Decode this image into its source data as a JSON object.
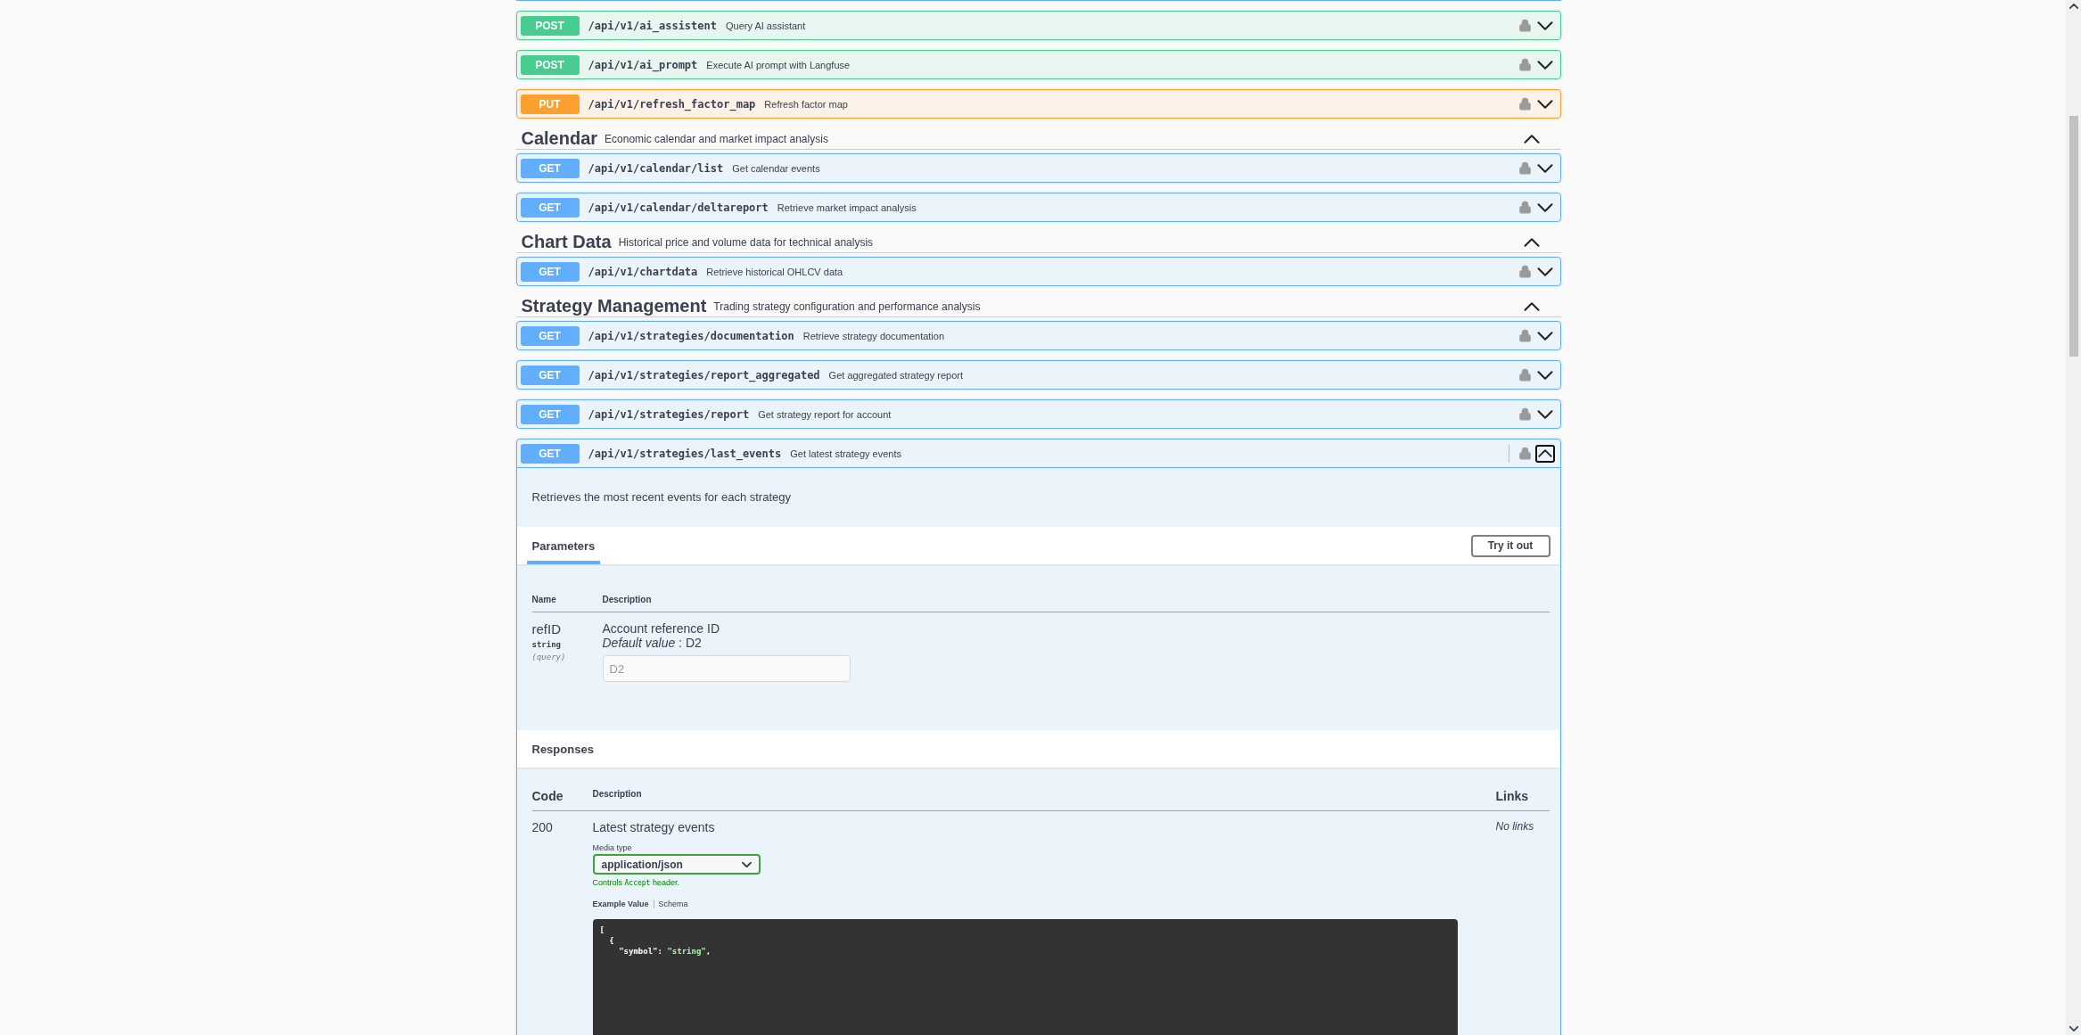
{
  "sections": [
    {
      "operations": [
        {
          "method": "POST",
          "path": "/api/v1/ai_assistent",
          "summary": "Query AI assistant",
          "expanded": false
        },
        {
          "method": "POST",
          "path": "/api/v1/ai_prompt",
          "summary": "Execute AI prompt with Langfuse",
          "expanded": false
        },
        {
          "method": "PUT",
          "path": "/api/v1/refresh_factor_map",
          "summary": "Refresh factor map",
          "expanded": false
        }
      ]
    },
    {
      "title": "Calendar",
      "description": "Economic calendar and market impact analysis",
      "expanded": true,
      "operations": [
        {
          "method": "GET",
          "path": "/api/v1/calendar/list",
          "summary": "Get calendar events",
          "expanded": false
        },
        {
          "method": "GET",
          "path": "/api/v1/calendar/deltareport",
          "summary": "Retrieve market impact analysis",
          "expanded": false
        }
      ]
    },
    {
      "title": "Chart Data",
      "description": "Historical price and volume data for technical analysis",
      "expanded": true,
      "operations": [
        {
          "method": "GET",
          "path": "/api/v1/chartdata",
          "summary": "Retrieve historical OHLCV data",
          "expanded": false
        }
      ]
    },
    {
      "title": "Strategy Management",
      "description": "Trading strategy configuration and performance analysis",
      "expanded": true,
      "operations": [
        {
          "method": "GET",
          "path": "/api/v1/strategies/documentation",
          "summary": "Retrieve strategy documentation",
          "expanded": false
        },
        {
          "method": "GET",
          "path": "/api/v1/strategies/report_aggregated",
          "summary": "Get aggregated strategy report",
          "expanded": false
        },
        {
          "method": "GET",
          "path": "/api/v1/strategies/report",
          "summary": "Get strategy report for account",
          "expanded": false
        },
        {
          "method": "GET",
          "path": "/api/v1/strategies/last_events",
          "summary": "Get latest strategy events",
          "expanded": true,
          "details": {
            "description": "Retrieves the most recent events for each strategy",
            "parameters_tab": "Parameters",
            "try_button": "Try it out",
            "param_columns": [
              "Name",
              "Description"
            ],
            "parameters": [
              {
                "name": "refID",
                "type": "string",
                "location": "(query)",
                "description": "Account reference ID",
                "default_label": "Default value",
                "default_separator": ":",
                "default_value": "D2",
                "placeholder": "D2"
              }
            ],
            "responses_title": "Responses",
            "response_columns": [
              "Code",
              "Description",
              "Links"
            ],
            "responses": [
              {
                "code": "200",
                "description": "Latest strategy events",
                "links": "No links",
                "media_type_label": "Media type",
                "media_type": "application/json",
                "note_before": "Controls",
                "note_code": "Accept",
                "note_after": "header.",
                "example_tabs": [
                  {
                    "label": "Example Value",
                    "selected": true
                  },
                  {
                    "label": "Schema",
                    "selected": false
                  }
                ],
                "example_lines": [
                  "[",
                  "  {",
                  "    \"symbol\": \"string\","
                ]
              }
            ]
          }
        }
      ]
    }
  ]
}
